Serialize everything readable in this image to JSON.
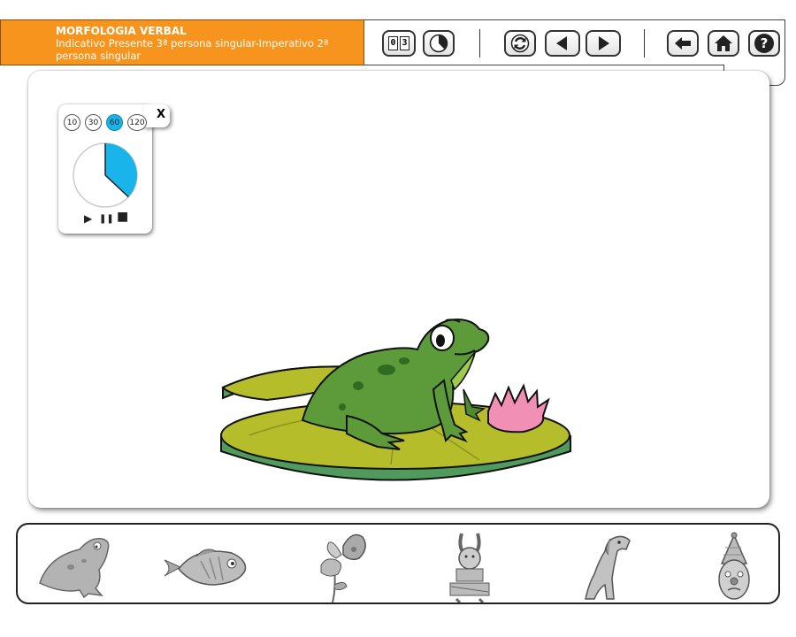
{
  "header": {
    "title": "MORFOLOGIA VERBAL",
    "subtitle": "Indicativo Presente 3ª persona singular-Imperativo 2ª persona singular"
  },
  "toolbar": {
    "counter_digits": [
      "0",
      "3"
    ],
    "buttons": [
      "counter-button",
      "timer-button",
      "reload-button",
      "previous-button",
      "next-button",
      "back-button",
      "home-button",
      "help-button"
    ]
  },
  "timer": {
    "options": [
      "10",
      "30",
      "60",
      "120"
    ],
    "selected": "60",
    "close_label": "X",
    "progress_fraction": 0.37,
    "controls": {
      "play": "▶",
      "pause": "❚❚",
      "stop": "■"
    },
    "fill_color": "#19b4ea"
  },
  "thumbnails": [
    "frog",
    "fish",
    "butterfly-flower",
    "rabbit-drummer",
    "dog",
    "clown"
  ],
  "colors": {
    "header_orange": "#f7941d",
    "frog_green": "#5d9b3a",
    "lilypad": "#b5bd2a",
    "lotus": "#f28fb5"
  }
}
